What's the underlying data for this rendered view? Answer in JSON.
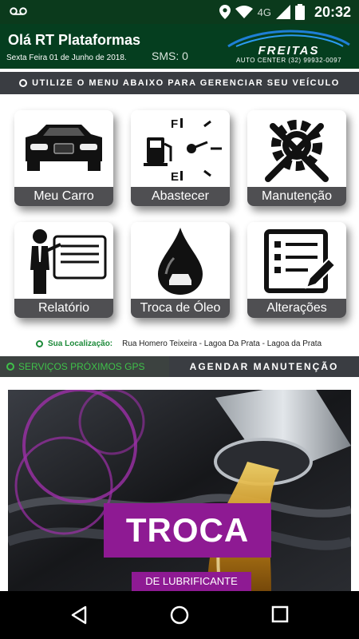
{
  "status_bar": {
    "time": "20:32",
    "network": "4G"
  },
  "header": {
    "greeting": "Olá RT Plataformas",
    "date": "Sexta Feira 01 de Junho de 2018.",
    "sms": "SMS: 0",
    "logo": {
      "brand": "FREITAS",
      "subtitle": "AUTO CENTER (32) 99932-0097"
    }
  },
  "instruction": "UTILIZE O MENU ABAIXO PARA GERENCIAR SEU VEÍCULO",
  "menu": {
    "items": [
      {
        "label": "Meu Carro",
        "icon": "car-front-icon"
      },
      {
        "label": "Abastecer",
        "icon": "fuel-gauge-icon"
      },
      {
        "label": "Manutenção",
        "icon": "gear-tools-icon"
      },
      {
        "label": "Relatório",
        "icon": "presenter-board-icon"
      },
      {
        "label": "Troca de Óleo",
        "icon": "oil-drop-icon"
      },
      {
        "label": "Alterações",
        "icon": "checklist-edit-icon"
      }
    ]
  },
  "location": {
    "label": "Sua Localização:",
    "value": "Rua Homero Teixeira - Lagoa Da Prata - Lagoa da Prata"
  },
  "actions": {
    "gps": "SERVIÇOS PRÓXIMOS GPS",
    "schedule": "AGENDAR MANUTENÇÃO"
  },
  "banner": {
    "title": "TROCA",
    "subtitle": "DE LUBRIFICANTE"
  },
  "colors": {
    "header_green": "#053e1f",
    "status_green": "#0b3a1c",
    "dark_bar": "#3a3d42",
    "gps_green": "#3fc14a",
    "promo_purple": "#8e1a93"
  }
}
